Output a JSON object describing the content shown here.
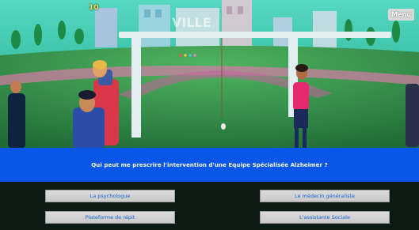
{
  "hud": {
    "score": "10",
    "menu_label": "Menu"
  },
  "scene": {
    "sign_text": "VILLE"
  },
  "question": {
    "text": "Qui peut me prescrire l'intervention d'une Equipe Spécialisée Alzheimer ?"
  },
  "answers": [
    {
      "label": "La psychologue"
    },
    {
      "label": "Le médecin généraliste"
    },
    {
      "label": "Plateforme de répit"
    },
    {
      "label": "L'assistante Sociale"
    }
  ],
  "colors": {
    "question_bar": "#0a56e8",
    "answer_text": "#1463d8",
    "sky": "#2fc7a8",
    "grass": "#3aa04e"
  }
}
